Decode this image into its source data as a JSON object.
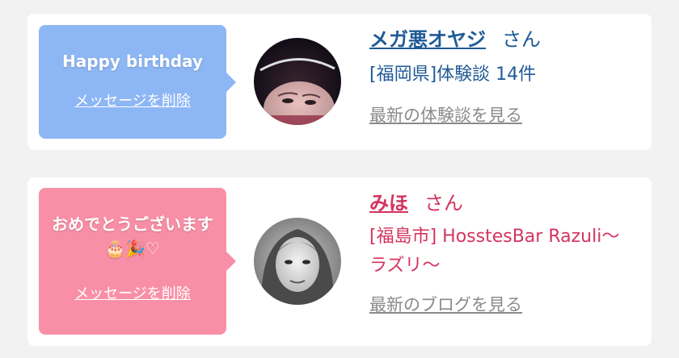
{
  "cards": [
    {
      "bubble_message": "Happy birthday",
      "delete_label": "メッセージを削除",
      "user_name": "メガ悪オヤジ",
      "honorific": "さん",
      "region_line": "[福岡県]体験談 14件",
      "view_link": "最新の体験談を見る",
      "theme_color": "#8db6f5",
      "text_color": "#1f5a96"
    },
    {
      "bubble_message": "おめでとうございます🎂🎉♡",
      "delete_label": "メッセージを削除",
      "user_name": "みほ",
      "honorific": "さん",
      "shop_line": "[福島市] HosstesBar Razuli～ラズリ～",
      "view_link": "最新のブログを見る",
      "theme_color": "#f98fa6",
      "text_color": "#d4345f"
    }
  ]
}
